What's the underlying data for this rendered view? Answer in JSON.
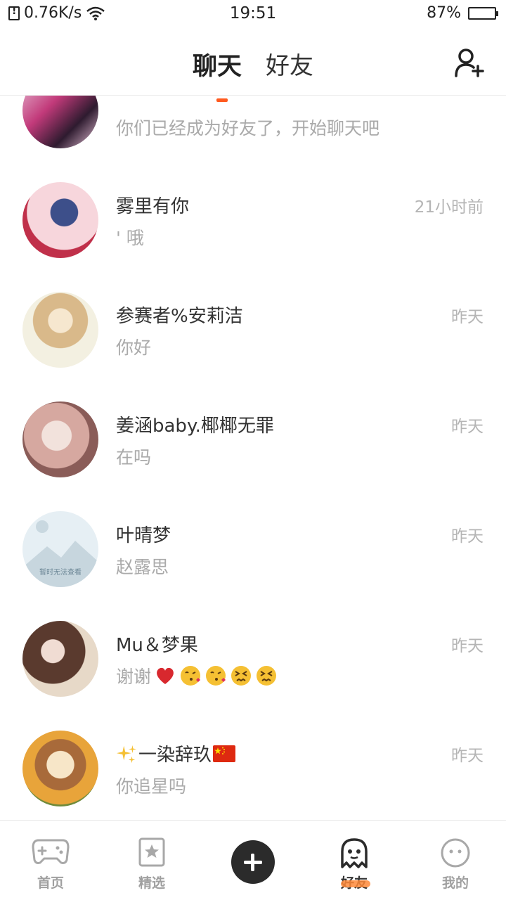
{
  "status_bar": {
    "speed": "0.76K/s",
    "time": "19:51",
    "battery": "87%",
    "battery_level": 0.87
  },
  "header": {
    "tabs": [
      {
        "label": "聊天",
        "active": true
      },
      {
        "label": "好友",
        "active": false
      }
    ],
    "add_friend_icon": "add-user-icon"
  },
  "chats": [
    {
      "name": "",
      "time": "",
      "preview": "你们已经成为好友了，开始聊天吧",
      "avatar_colors": [
        "#c23a7a",
        "#2e1b2f",
        "#e8c2d8"
      ]
    },
    {
      "name": "雾里有你",
      "time": "21小时前",
      "preview": "' 哦",
      "avatar_colors": [
        "#f7d6dc",
        "#3d4f8a",
        "#c0304a"
      ]
    },
    {
      "name": "参赛者%安莉洁",
      "time": "昨天",
      "preview": "你好",
      "avatar_colors": [
        "#f3f0e1",
        "#d9b98a",
        "#7a8a5e"
      ]
    },
    {
      "name": "姜涵baby.椰椰无罪",
      "time": "昨天",
      "preview": "在吗",
      "avatar_colors": [
        "#d6a8a0",
        "#8a5c58",
        "#f2e2dc"
      ]
    },
    {
      "name": "叶晴梦",
      "time": "昨天",
      "preview": "赵露思",
      "avatar_colors": [
        "#dde8ee",
        "#b7c9d3",
        "#8aa4b2"
      ],
      "placeholder_text": "暂时无法查看"
    },
    {
      "name": "Mu＆梦果",
      "time": "昨天",
      "preview": "谢谢",
      "preview_emojis": [
        "red-heart",
        "kiss",
        "kiss",
        "confounded",
        "confounded"
      ],
      "avatar_colors": [
        "#e7d9c8",
        "#5a3a2e",
        "#c98aa0"
      ]
    },
    {
      "name": "一染辞玖",
      "name_prefix_emoji": "sparkles",
      "name_suffix_emoji": "china-flag",
      "time": "昨天",
      "preview": "你追星吗",
      "avatar_colors": [
        "#e8a43a",
        "#6f8a3a",
        "#f7e6c8"
      ]
    }
  ],
  "tabbar": {
    "items": [
      {
        "label": "首页",
        "icon": "gamepad-icon",
        "active": false
      },
      {
        "label": "精选",
        "icon": "star-bookmark-icon",
        "active": false
      },
      {
        "label": "",
        "icon": "plus-icon",
        "active": false
      },
      {
        "label": "好友",
        "icon": "ghost-icon",
        "active": true
      },
      {
        "label": "我的",
        "icon": "face-icon",
        "active": false
      }
    ]
  }
}
